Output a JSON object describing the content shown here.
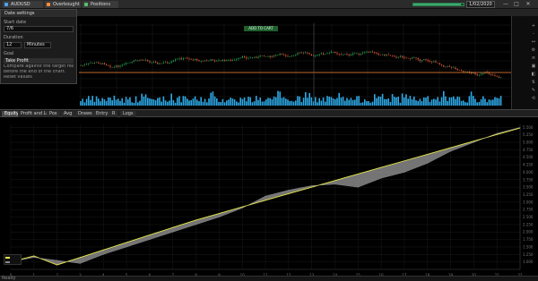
{
  "tabs": [
    {
      "label": "AUDUSD",
      "color": "#4da3ff"
    },
    {
      "label": "Overbought",
      "color": "#ff8c3a"
    },
    {
      "label": "Positions",
      "color": "#53c26f"
    }
  ],
  "top_controls": {
    "date_value": "1/02/2020",
    "progress": 0.95,
    "minimize": "—",
    "maximize": "□",
    "close": "✕"
  },
  "popup": {
    "title": "Date settings",
    "field1_label": "Start date",
    "field1_value": "7/6",
    "field2_label": "Duration",
    "field2_value": "12",
    "field2_unit": "Minutes",
    "field3_label": "Goal",
    "field3_value": "Take Profit",
    "note1": "Compare against the target reached",
    "note2": "before the end of the chart.",
    "note3": "Reset values"
  },
  "upper_chart": {
    "banner": "ADD TO CART",
    "price_colors": {
      "up": "#26a65b",
      "down": "#e05c3a",
      "volume": "#2ea9e6",
      "hline": "#ff8c3a"
    }
  },
  "sidebar_tools": [
    "+",
    "-",
    "↔",
    "⚙",
    "≡",
    "▣",
    "◧",
    "⇅",
    "✎",
    "⟲"
  ],
  "toolbar2": [
    {
      "label": "Equity",
      "active": true
    },
    {
      "label": "Profit and Loss",
      "active": false
    },
    {
      "label": "Pos",
      "active": false
    },
    {
      "label": "Avg",
      "active": false
    },
    {
      "label": "Draws",
      "active": false
    },
    {
      "label": "Entry",
      "active": false
    },
    {
      "label": "R",
      "active": false
    },
    {
      "label": "Logs",
      "active": false
    }
  ],
  "chart_data": {
    "type": "line",
    "x": [
      0,
      1,
      2,
      3,
      4,
      5,
      6,
      7,
      8,
      9,
      10,
      11,
      12,
      13,
      14,
      15,
      16,
      17,
      18,
      19,
      20,
      21,
      22
    ],
    "series": [
      {
        "name": "",
        "color": "#e8e84a",
        "values": [
          1.0,
          1.2,
          0.9,
          1.15,
          1.4,
          1.65,
          1.9,
          2.15,
          2.4,
          2.62,
          2.84,
          3.06,
          3.28,
          3.5,
          3.72,
          3.94,
          4.16,
          4.38,
          4.6,
          4.82,
          5.04,
          5.26,
          5.48
        ]
      },
      {
        "name": "",
        "color": "#8a8a8a",
        "values": [
          1.0,
          1.15,
          1.05,
          0.95,
          1.25,
          1.5,
          1.75,
          2.0,
          2.25,
          2.5,
          2.8,
          3.2,
          3.4,
          3.55,
          3.6,
          3.5,
          3.8,
          4.0,
          4.3,
          4.7,
          5.0,
          5.3,
          5.5
        ]
      }
    ],
    "band_color": "#9b9b9b",
    "yticks": [
      "1.000",
      "1.250",
      "1.500",
      "1.750",
      "2.000",
      "2.250",
      "2.500",
      "2.750",
      "3.000",
      "3.250",
      "3.500",
      "3.750",
      "4.000",
      "4.250",
      "4.500",
      "4.750",
      "5.000",
      "5.250",
      "5.500"
    ],
    "xticks": [
      "0",
      "1",
      "2",
      "3",
      "4",
      "5",
      "6",
      "7",
      "8",
      "9",
      "10",
      "11",
      "12",
      "13",
      "14",
      "15",
      "16",
      "17",
      "18",
      "19",
      "20",
      "21",
      "22"
    ],
    "ylim": [
      0.75,
      5.6
    ],
    "grid": true,
    "legend_position": "bottom-left"
  },
  "status": {
    "text": "Ready"
  }
}
